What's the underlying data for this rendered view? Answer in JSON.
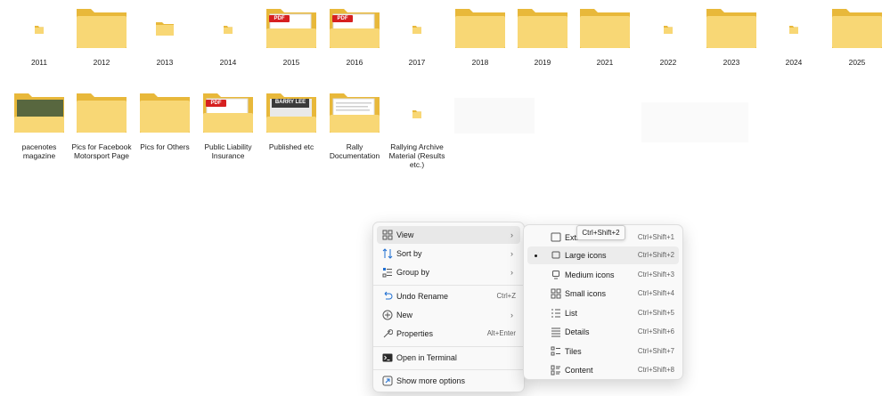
{
  "colors": {
    "folder_back": "#e8b83a",
    "folder_front": "#f8d775",
    "pdf_red": "#d62020",
    "menu_bg": "#f9f9f9"
  },
  "folders_row1": [
    {
      "label": "2011",
      "icon": "small-folder-icon"
    },
    {
      "label": "2012",
      "icon": "folder-icon"
    },
    {
      "label": "2013",
      "icon": "small-folder-icon"
    },
    {
      "label": "2014",
      "icon": "small-folder-icon"
    },
    {
      "label": "2015",
      "icon": "folder-pdf-icon",
      "badge": "PDF"
    },
    {
      "label": "2016",
      "icon": "folder-pdf-icon",
      "badge": "PDF"
    },
    {
      "label": "2017",
      "icon": "small-folder-icon"
    },
    {
      "label": "2018",
      "icon": "folder-icon"
    },
    {
      "label": "2019",
      "icon": "folder-icon"
    },
    {
      "label": "2021",
      "icon": "folder-icon"
    },
    {
      "label": "2022",
      "icon": "small-folder-icon"
    },
    {
      "label": "2023",
      "icon": "folder-icon"
    },
    {
      "label": "2024",
      "icon": "small-folder-icon"
    },
    {
      "label": "2025",
      "icon": "folder-icon"
    }
  ],
  "folders_row2": [
    {
      "label": "pacenotes magazine",
      "icon": "folder-photo-icon"
    },
    {
      "label": "Pics for Facebook Motorsport Page",
      "icon": "folder-icon"
    },
    {
      "label": "Pics for Others",
      "icon": "folder-icon"
    },
    {
      "label": "Public Liability Insurance",
      "icon": "folder-pdf-icon",
      "badge": "PDF"
    },
    {
      "label": "Published etc",
      "icon": "folder-photo-icon",
      "badge": "BARRY LEE"
    },
    {
      "label": "Rally Documentation",
      "icon": "folder-document-icon"
    },
    {
      "label": "Rallying Archive Material (Results etc.)",
      "icon": "small-folder-icon"
    }
  ],
  "context_menu": {
    "items": [
      {
        "label": "View",
        "icon": "view-icon",
        "submenu": true
      },
      {
        "label": "Sort by",
        "icon": "sort-icon",
        "submenu": true
      },
      {
        "label": "Group by",
        "icon": "group-icon",
        "submenu": true
      },
      {
        "label": "Undo Rename",
        "icon": "undo-icon",
        "shortcut": "Ctrl+Z"
      },
      {
        "label": "New",
        "icon": "new-icon",
        "submenu": true
      },
      {
        "label": "Properties",
        "icon": "properties-icon",
        "shortcut": "Alt+Enter"
      },
      {
        "label": "Open in Terminal",
        "icon": "terminal-icon"
      },
      {
        "label": "Show more options",
        "icon": "more-options-icon"
      }
    ]
  },
  "view_submenu": {
    "selected": "Large icons",
    "items": [
      {
        "label": "Extr",
        "shortcut": "Ctrl+Shift+1",
        "icon": "extra-large-icons-icon"
      },
      {
        "label": "Large icons",
        "shortcut": "Ctrl+Shift+2",
        "icon": "large-icons-icon"
      },
      {
        "label": "Medium icons",
        "shortcut": "Ctrl+Shift+3",
        "icon": "medium-icons-icon"
      },
      {
        "label": "Small icons",
        "shortcut": "Ctrl+Shift+4",
        "icon": "small-icons-icon"
      },
      {
        "label": "List",
        "shortcut": "Ctrl+Shift+5",
        "icon": "list-icon"
      },
      {
        "label": "Details",
        "shortcut": "Ctrl+Shift+6",
        "icon": "details-icon"
      },
      {
        "label": "Tiles",
        "shortcut": "Ctrl+Shift+7",
        "icon": "tiles-icon"
      },
      {
        "label": "Content",
        "shortcut": "Ctrl+Shift+8",
        "icon": "content-icon"
      }
    ]
  },
  "tooltip": "Ctrl+Shift+2"
}
